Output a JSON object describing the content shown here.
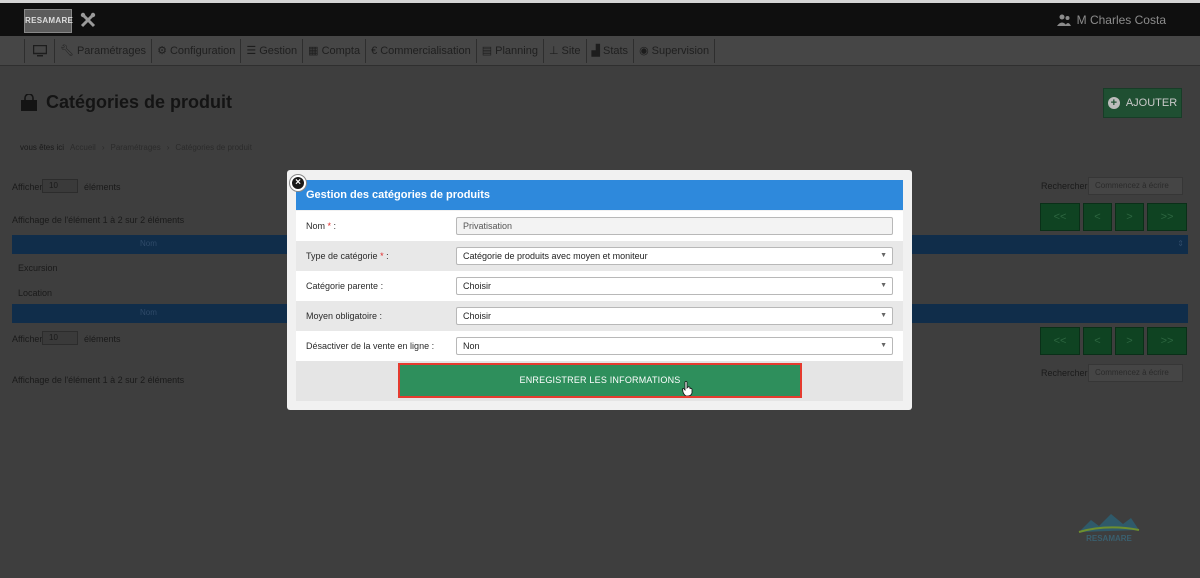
{
  "topbar": {
    "logo_text": "RESAMARE",
    "user_name": "M Charles Costa",
    "tools_icon": "crossed-tools-icon"
  },
  "nav": {
    "items": [
      {
        "label": "",
        "icon": "monitor-icon"
      },
      {
        "label": "Paramétrages",
        "icon": "wrench-icon"
      },
      {
        "label": "Configuration",
        "icon": "cogs-icon"
      },
      {
        "label": "Gestion",
        "icon": "list-icon"
      },
      {
        "label": "Compta",
        "icon": "calculator-icon"
      },
      {
        "label": "Commercialisation",
        "icon": "euro-icon"
      },
      {
        "label": "Planning",
        "icon": "calendar-icon"
      },
      {
        "label": "Site",
        "icon": "sitemap-icon"
      },
      {
        "label": "Stats",
        "icon": "chart-icon"
      },
      {
        "label": "Supervision",
        "icon": "eye-icon"
      }
    ]
  },
  "page": {
    "title": "Catégories de produit",
    "add_label": "AJOUTER",
    "breadcrumb": {
      "prefix": "vous êtes ici",
      "items": [
        "Accueil",
        "Paramétrages",
        "Catégories de produit"
      ]
    },
    "show_label": "Afficher",
    "show_value": "10",
    "show_suffix": "éléments",
    "info_top": "Affichage de l'élément 1 à 2 sur 2 éléments",
    "info_bottom": "Affichage de l'élément 1 à 2 sur 2 éléments",
    "search_label": "Rechercher",
    "search_placeholder": "Commencez à écrire",
    "col_header": "Nom",
    "rows": [
      "Excursion",
      "Location"
    ],
    "pager": [
      "<<",
      "<",
      ">",
      ">>"
    ]
  },
  "modal": {
    "title": "Gestion des catégories de produits",
    "fields": [
      {
        "label": "Nom",
        "required": true,
        "value": "Privatisation",
        "type": "input"
      },
      {
        "label": "Type de catégorie",
        "required": true,
        "value": "Catégorie de produits avec moyen et moniteur",
        "type": "select"
      },
      {
        "label": "Catégorie parente",
        "required": false,
        "value": "Choisir",
        "type": "select"
      },
      {
        "label": "Moyen obligatoire",
        "required": false,
        "value": "Choisir",
        "type": "select"
      },
      {
        "label": "Désactiver de la vente en ligne",
        "required": false,
        "value": "Non",
        "type": "select"
      }
    ],
    "required_mark": "*",
    "colon": " :",
    "submit_label": "ENREGISTRER LES INFORMATIONS",
    "close_glyph": "×"
  },
  "brand_bottom": "RESAMARE",
  "colors": {
    "modal_header": "#2e89dc",
    "submit": "#2e8f5c",
    "highlight_border": "#e53b2f",
    "required": "#e02a2a"
  }
}
